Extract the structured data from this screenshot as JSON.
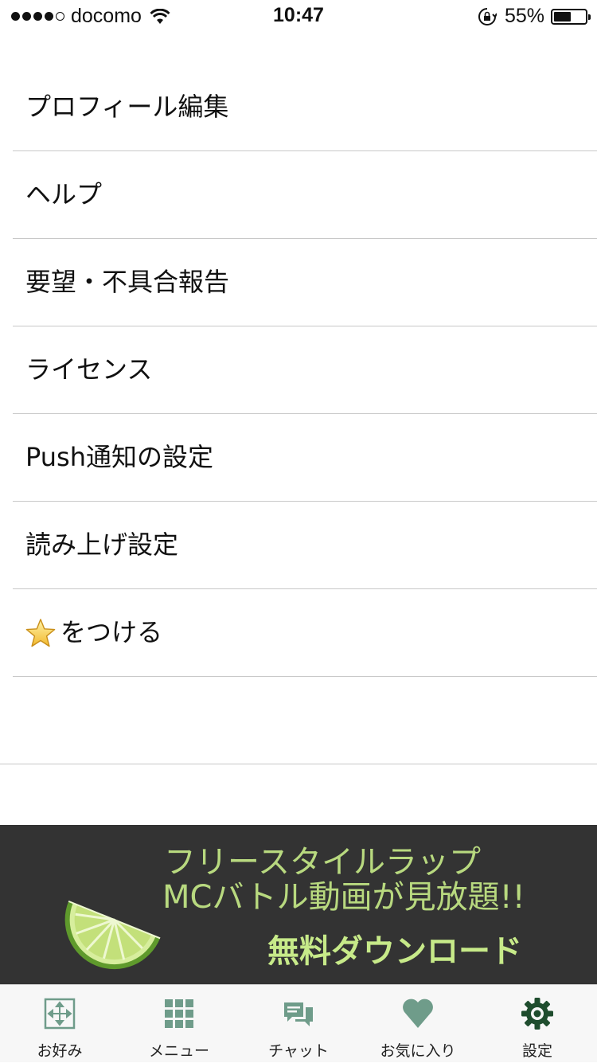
{
  "status_bar": {
    "carrier": "docomo",
    "time": "10:47",
    "battery_percent_text": "55%",
    "battery_level": 0.55,
    "signal_bars": 4,
    "signal_total": 5
  },
  "menu": {
    "items": [
      {
        "label": "プロフィール編集"
      },
      {
        "label": "ヘルプ"
      },
      {
        "label": "要望・不具合報告"
      },
      {
        "label": "ライセンス"
      },
      {
        "label": "Push通知の設定"
      },
      {
        "label": "読み上げ設定"
      },
      {
        "label": "をつける",
        "icon": "star-icon"
      }
    ]
  },
  "banner": {
    "line1": "フリースタイルラップ",
    "line2": "MCバトル動画が見放題!!",
    "cta": "無料ダウンロード",
    "text_color": "#b8d97f",
    "background": "#333333"
  },
  "tab_bar": {
    "tabs": [
      {
        "label": "お好み",
        "icon": "crosshair-arrows-icon"
      },
      {
        "label": "メニュー",
        "icon": "grid-icon"
      },
      {
        "label": "チャット",
        "icon": "chat-bubbles-icon"
      },
      {
        "label": "お気に入り",
        "icon": "heart-icon"
      },
      {
        "label": "設定",
        "icon": "gear-icon",
        "active": true
      }
    ],
    "icon_color": "#6f9c8a",
    "active_color": "#1f4d2e"
  }
}
